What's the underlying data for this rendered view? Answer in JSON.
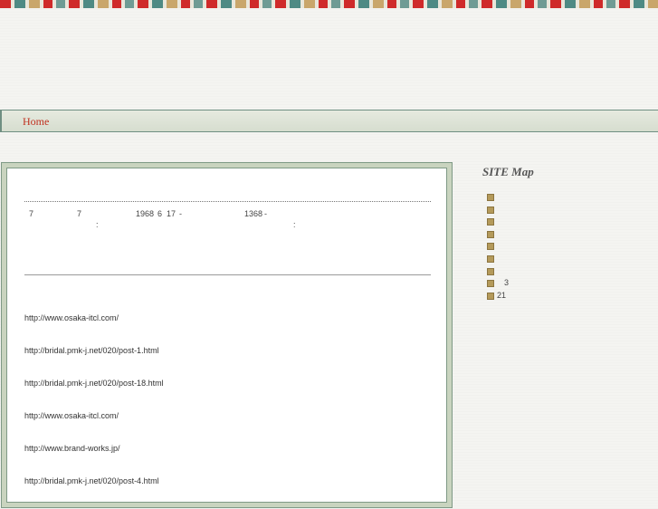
{
  "header": {
    "stripe_colors": [
      "#cf2a2a",
      "#4e8a84",
      "#c9a66b",
      "#6f9b94",
      "#e9e6da"
    ]
  },
  "nav": {
    "home_label": "Home"
  },
  "main": {
    "info_row1": {
      "a": "7",
      "b": "7",
      "c": "1968",
      "d": "6",
      "e": "17",
      "f": "-",
      "g": "1368",
      "h": "-"
    },
    "info_row2": {
      "a": ":",
      "b": ":"
    },
    "links": [
      "http://www.osaka-itcl.com/",
      "http://bridal.pmk-j.net/020/post-1.html",
      "http://bridal.pmk-j.net/020/post-18.html",
      "http://www.osaka-itcl.com/",
      "http://www.brand-works.jp/",
      "http://bridal.pmk-j.net/020/post-4.html"
    ]
  },
  "sidebar": {
    "title": "SITE Map",
    "items": [
      "",
      "",
      "",
      "",
      "",
      "",
      "",
      "3",
      "21"
    ]
  }
}
